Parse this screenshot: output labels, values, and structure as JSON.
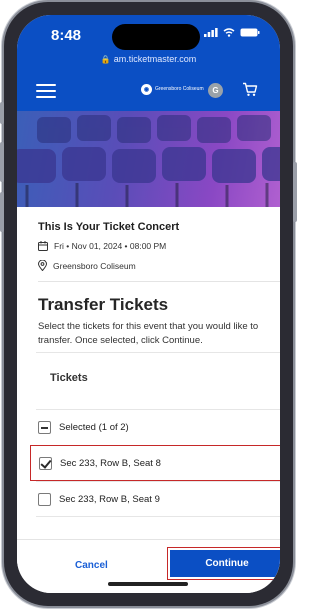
{
  "status_bar": {
    "time": "8:48"
  },
  "browser": {
    "url": "am.ticketmaster.com"
  },
  "nav": {
    "venue_logo_text": "Greensboro Coliseum",
    "avatar_initial": "G"
  },
  "event": {
    "title": "This Is Your Ticket Concert",
    "date": "Fri • Nov 01, 2024 • 08:00 PM",
    "venue": "Greensboro Coliseum"
  },
  "transfer": {
    "title": "Transfer Tickets",
    "instructions": "Select the tickets for this event that you would like to transfer. Once selected, click Continue."
  },
  "tickets": {
    "header": "Tickets",
    "selected_label": "Selected (1 of 2)",
    "items": [
      {
        "label": "Sec 233, Row B, Seat 8",
        "checked": true
      },
      {
        "label": "Sec 233, Row B, Seat 9",
        "checked": false
      }
    ]
  },
  "footer": {
    "cancel_label": "Cancel",
    "continue_label": "Continue"
  },
  "colors": {
    "brand_blue": "#0b4fc4",
    "highlight_red": "#c62828"
  }
}
